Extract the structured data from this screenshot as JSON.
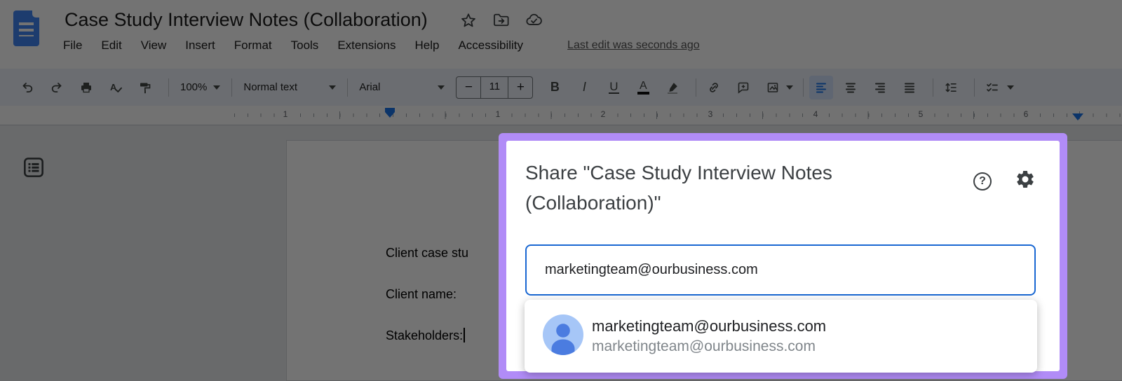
{
  "header": {
    "doc_title": "Case Study Interview Notes (Collaboration)",
    "menu_items": [
      "File",
      "Edit",
      "View",
      "Insert",
      "Format",
      "Tools",
      "Extensions",
      "Help",
      "Accessibility"
    ],
    "last_edit_label": "Last edit was seconds ago",
    "icons": [
      "google-docs-logo",
      "star-icon",
      "move-folder-icon",
      "cloud-saved-icon"
    ]
  },
  "toolbar": {
    "zoom_value": "100%",
    "style_value": "Normal text",
    "font_value": "Arial",
    "font_size": "11",
    "decrease_glyph": "−",
    "increase_glyph": "+",
    "glyphs": {
      "bold": "B",
      "italic": "I",
      "underline": "U",
      "text_color": "A"
    },
    "icons": [
      "undo",
      "redo",
      "print",
      "spell-check",
      "paint-format",
      "insert-link",
      "add-comment",
      "insert-image",
      "align-left",
      "align-center",
      "align-right",
      "justify",
      "line-spacing",
      "checklist"
    ],
    "active_item": "align-left"
  },
  "ruler": {
    "numbers": [
      "1",
      "1",
      "2",
      "3",
      "4",
      "5",
      "6"
    ]
  },
  "document": {
    "lines": [
      "Client case stu",
      "Client name:",
      "Stakeholders:"
    ],
    "icons": [
      "document-outline"
    ]
  },
  "share_dialog": {
    "title": "Share \"Case Study Interview Notes (Collaboration)\"",
    "help_glyph": "?",
    "input_value": "marketingteam@ourbusiness.com",
    "suggestion": {
      "name": "marketingteam@ourbusiness.com",
      "email": "marketingteam@ourbusiness.com"
    },
    "icons": [
      "help-icon",
      "settings-gear-icon",
      "person-avatar"
    ]
  },
  "colors": {
    "accent_blue": "#1a73e8",
    "chip_blue": "#d2e3fc",
    "toolbar_bg": "#edf2fa",
    "canvas_bg": "#e9ebee",
    "logo_blue": "#4285f4",
    "purple": "#b18cf7",
    "input_border": "#1967d2",
    "avatar_bg": "#a6c6f7",
    "avatar_person": "#4b7ce0"
  }
}
